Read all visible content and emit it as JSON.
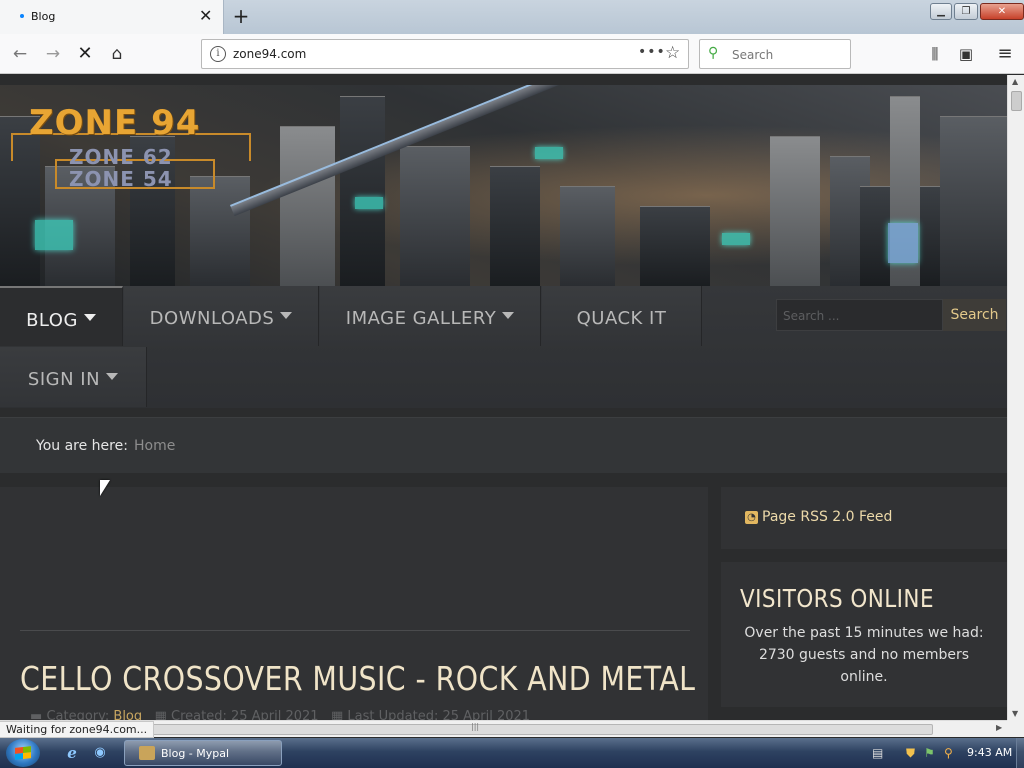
{
  "browser": {
    "tab_title": "Blog",
    "url": "zone94.com",
    "search_placeholder": "Search",
    "status_text": "Waiting for zone94.com..."
  },
  "site": {
    "logo": {
      "line1": "ZONE 94",
      "line2": "ZONE 62",
      "line3": "ZONE 54"
    },
    "menu": {
      "items": [
        {
          "label": "BLOG",
          "has_dropdown": true,
          "active": true
        },
        {
          "label": "DOWNLOADS",
          "has_dropdown": true
        },
        {
          "label": "IMAGE GALLERY",
          "has_dropdown": true
        },
        {
          "label": "QUACK IT",
          "has_dropdown": false
        },
        {
          "label": "SIGN IN",
          "has_dropdown": true
        }
      ],
      "search_placeholder": "Search ...",
      "search_button": "Search"
    },
    "breadcrumb": {
      "prefix": "You are here:",
      "current": "Home"
    },
    "article": {
      "title": "CELLO CROSSOVER MUSIC - ROCK AND METAL",
      "meta_category_label": "Category:",
      "meta_category": "Blog",
      "meta_created": "Created: 25 April 2021",
      "meta_updated": "Last Updated: 25 April 2021"
    },
    "sidebar": {
      "rss_label": "Page RSS 2.0 Feed",
      "visitors_title": "VISITORS ONLINE",
      "visitors_text": "Over the past 15 minutes we had: 2730 guests and no members online."
    }
  },
  "taskbar": {
    "task_label": "Blog - Mypal",
    "clock": "9:43 AM"
  },
  "icons": {
    "back": "arrow-left-icon",
    "forward": "arrow-right-icon",
    "stop": "close-icon",
    "home": "home-icon",
    "info": "info-icon",
    "more": "ellipsis-icon",
    "bookmark": "star-icon",
    "library": "library-icon",
    "sidebar": "sidebar-icon",
    "menu": "hamburger-icon",
    "rss": "rss-icon"
  },
  "colors": {
    "accent": "#e8a533",
    "heading": "#f0e4c8",
    "link": "#c8a660"
  }
}
